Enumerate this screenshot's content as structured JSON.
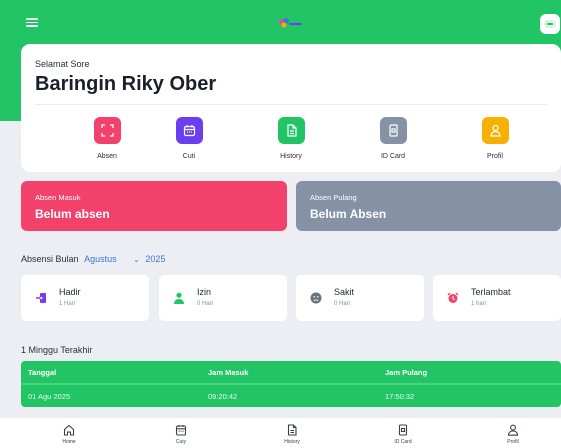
{
  "header": {
    "menu_icon": "hamburger-icon",
    "logo_icon": "app-logo",
    "profile_icon": "avatar-icon"
  },
  "greeting": {
    "label": "Selamat Sore",
    "name": "Baringin Riky Ober"
  },
  "menu": [
    {
      "label": "Absen",
      "icon": "scan-icon",
      "color": "#f2426c"
    },
    {
      "label": "Cuti",
      "icon": "calendar-icon",
      "color": "#6a3ff0"
    },
    {
      "label": "History",
      "icon": "document-icon",
      "color": "#22c565"
    },
    {
      "label": "ID Card",
      "icon": "id-card-icon",
      "color": "#8592a6"
    },
    {
      "label": "Profil",
      "icon": "user-icon",
      "color": "#f5b000"
    }
  ],
  "status": {
    "in_title": "Absen Masuk",
    "in_value": "Belum absen",
    "out_title": "Absen Pulang",
    "out_value": "Belum Absen"
  },
  "month_filter": {
    "label": "Absensi Bulan",
    "month": "Agustus",
    "year": "2025"
  },
  "stats": [
    {
      "name": "Hadir",
      "count": "1 Hari",
      "icon": "login-icon",
      "color": "#7c3aed"
    },
    {
      "name": "Izin",
      "count": "0 Hari",
      "icon": "person-icon",
      "color": "#22c565"
    },
    {
      "name": "Sakit",
      "count": "0 Hari",
      "icon": "sad-face-icon",
      "color": "#6b7280"
    },
    {
      "name": "Terlambat",
      "count": "1 hari",
      "icon": "alarm-icon",
      "color": "#f2426c"
    }
  ],
  "recent": {
    "title": "1 Minggu Terakhir",
    "columns": [
      "Tanggal",
      "Jam Masuk",
      "Jam Pulang"
    ],
    "rows": [
      [
        "01 Agu 2025",
        "09:20:42",
        "17:50:32"
      ]
    ]
  },
  "bottom_nav": [
    {
      "label": "Home",
      "icon": "home-icon"
    },
    {
      "label": "Cuty",
      "icon": "calendar-icon"
    },
    {
      "label": "History",
      "icon": "document-icon"
    },
    {
      "label": "ID Card",
      "icon": "id-card-icon"
    },
    {
      "label": "Profil",
      "icon": "user-icon"
    }
  ]
}
